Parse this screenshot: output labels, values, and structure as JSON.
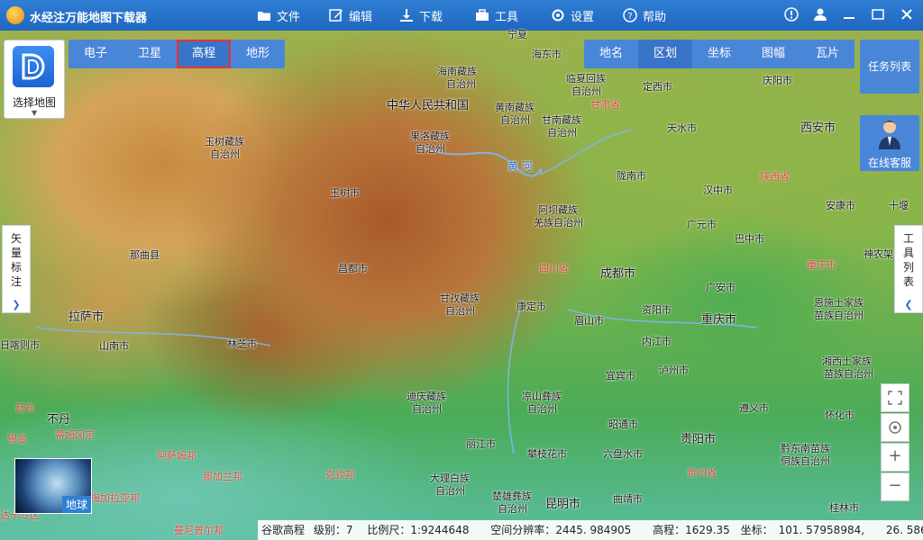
{
  "app": {
    "title": "水经注万能地图下载器"
  },
  "menu": [
    {
      "label": "文件",
      "icon": "folder-icon"
    },
    {
      "label": "编辑",
      "icon": "edit-icon"
    },
    {
      "label": "下载",
      "icon": "download-icon"
    },
    {
      "label": "工具",
      "icon": "toolbox-icon"
    },
    {
      "label": "设置",
      "icon": "gear-icon"
    },
    {
      "label": "帮助",
      "icon": "help-icon"
    }
  ],
  "window_controls": [
    "info-icon",
    "user-icon",
    "minimize-icon",
    "restore-icon",
    "close-icon"
  ],
  "select_map": {
    "label": "选择地图"
  },
  "map_tabs": [
    {
      "label": "电子",
      "active": false
    },
    {
      "label": "卫星",
      "active": false
    },
    {
      "label": "高程",
      "active": true
    },
    {
      "label": "地形",
      "active": false
    }
  ],
  "overlay_tabs": [
    {
      "label": "地名",
      "active": false
    },
    {
      "label": "区划",
      "active": true
    },
    {
      "label": "坐标",
      "active": false
    },
    {
      "label": "图幅",
      "active": false
    },
    {
      "label": "瓦片",
      "active": false
    }
  ],
  "task_list": {
    "label": "任务列表"
  },
  "support": {
    "label": "在线客服"
  },
  "left_panel": {
    "label": "矢量标注"
  },
  "right_panel": {
    "label": "工具列表"
  },
  "globe": {
    "label": "地球"
  },
  "status": {
    "source": "谷歌高程",
    "level_label": "级别：",
    "level": "7",
    "scale_label": "比例尺：",
    "scale": "1:9244648",
    "resolution_label": "空间分辨率：",
    "resolution": "2445. 984905",
    "elevation_label": "高程：",
    "elevation": "1629.35",
    "coord_label": "坐标：",
    "lon": "101. 57958984,",
    "lat": "26. 5869140"
  },
  "map_labels": {
    "country": "中华人民共和国",
    "river": "黄 河",
    "places": [
      "宁夏",
      "海东市",
      "海南藏族",
      "自治州",
      "临夏回族",
      "自治州",
      "定西市",
      "庆阳市",
      "甘肃省",
      "黄南藏族",
      "自治州",
      "甘南藏族",
      "自治州",
      "天水市",
      "西安市",
      "果洛藏族",
      "自治州",
      "玉树藏族",
      "自治州",
      "玉树市",
      "陇南市",
      "陕西省",
      "汉中市",
      "阿坝藏族",
      "羌族自治州",
      "安康市",
      "十堰",
      "广元市",
      "巴中市",
      "神农架",
      "那曲县",
      "昌都市",
      "四川省",
      "成都市",
      "重庆市",
      "广安市",
      "恩施土家族",
      "苗族自治州",
      "拉萨市",
      "甘孜藏族",
      "自治州",
      "康定市",
      "眉山市",
      "资阳市",
      "重庆市",
      "日喀则市",
      "山南市",
      "林芝市",
      "内江市",
      "湘西土家族",
      "苗族自治州",
      "宜宾市",
      "泸州市",
      "迪庆藏族",
      "自治州",
      "凉山彝族",
      "自治州",
      "遵义市",
      "不丹",
      "昭通市",
      "怀化市",
      "廷布",
      "锡金",
      "蒂姆冈宗",
      "丽江市",
      "贵阳市",
      "攀枝花市",
      "六盘水市",
      "黔东南苗族",
      "侗族自治州",
      "阿萨姆邦",
      "大理白族",
      "自治州",
      "那加兰邦",
      "克钦邦",
      "贵州省",
      "楚雄彝族",
      "自治州",
      "昆明市",
      "曲靖市",
      "梅加拉亚邦",
      "桂林市",
      "曼尼普尔邦",
      "达卡专区"
    ]
  }
}
